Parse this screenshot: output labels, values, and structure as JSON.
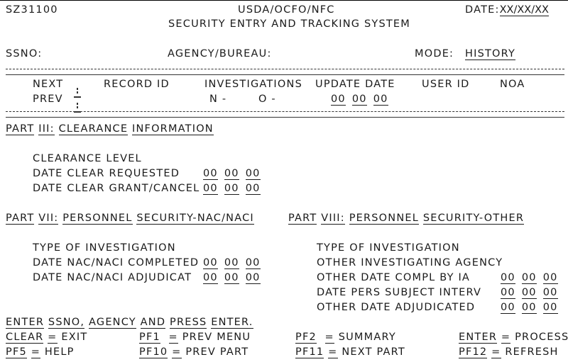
{
  "header": {
    "screen_id": "SZ31100",
    "org": "USDA/OCFO/NFC",
    "date_label": "DATE:",
    "date_value": "XX/XX/XX",
    "title": "SECURITY ENTRY AND TRACKING SYSTEM"
  },
  "keys": {
    "ssno_label": "SSNO:",
    "ssno_value": "",
    "agency_label": "AGENCY/BUREAU:",
    "agency_value": "",
    "mode_label": "MODE:",
    "mode_value": "HISTORY"
  },
  "record_header": {
    "next_label": "NEXT",
    "prev_label": "PREV",
    "columns": [
      "RECORD ID",
      "INVESTIGATIONS",
      "UPDATE DATE",
      "USER ID",
      "NOA"
    ],
    "investigations_n": "N -",
    "investigations_o": "O -",
    "update_date": [
      "00",
      "00",
      "00"
    ]
  },
  "part3": {
    "title_words": [
      "PART",
      "III:",
      "CLEARANCE",
      "INFORMATION"
    ],
    "clearance_level_label": "CLEARANCE LEVEL",
    "requested_label": "DATE CLEAR REQUESTED",
    "requested_date": [
      "00",
      "00",
      "00"
    ],
    "grant_label": "DATE CLEAR GRANT/CANCEL",
    "grant_date": [
      "00",
      "00",
      "00"
    ]
  },
  "part7": {
    "title_words": [
      "PART",
      "VII:",
      "PERSONNEL",
      "SECURITY-NAC/NACI"
    ],
    "type_label": "TYPE OF INVESTIGATION",
    "completed_label": "DATE NAC/NACI COMPLETED",
    "completed_date": [
      "00",
      "00",
      "00"
    ],
    "adjudicat_label": "DATE NAC/NACI ADJUDICAT",
    "adjudicat_date": [
      "00",
      "00",
      "00"
    ]
  },
  "part8": {
    "title_words": [
      "PART",
      "VIII:",
      "PERSONNEL",
      "SECURITY-OTHER"
    ],
    "type_label": "TYPE OF INVESTIGATION",
    "agency_label": "OTHER INVESTIGATING AGENCY",
    "compl_label": "OTHER DATE COMPL BY IA",
    "compl_date": [
      "00",
      "00",
      "00"
    ],
    "interv_label": "DATE PERS SUBJECT INTERV",
    "interv_date": [
      "00",
      "00",
      "00"
    ],
    "adjud_label": "OTHER DATE ADJUDICATED",
    "adjud_date": [
      "00",
      "00",
      "00"
    ]
  },
  "footer": {
    "message_words": [
      "ENTER",
      "SSNO,",
      "AGENCY",
      "AND",
      "PRESS",
      "ENTER."
    ],
    "eq": "=",
    "fkeys": [
      {
        "key": "CLEAR",
        "action": "EXIT"
      },
      {
        "key": "PF1",
        "action": "PREV MENU"
      },
      {
        "key": "PF2",
        "action": "SUMMARY"
      },
      {
        "key": "ENTER",
        "action": "PROCESS"
      },
      {
        "key": "PF5",
        "action": "HELP"
      },
      {
        "key": "PF10",
        "action": "PREV PART"
      },
      {
        "key": "PF11",
        "action": "NEXT PART"
      },
      {
        "key": "PF12",
        "action": "REFRESH"
      }
    ]
  }
}
